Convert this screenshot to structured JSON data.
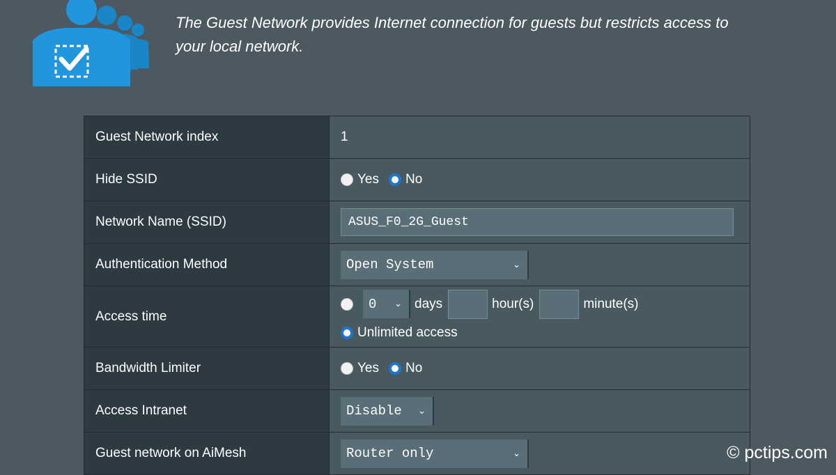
{
  "intro": {
    "text": "The Guest Network provides Internet connection for guests but restricts access to your local network."
  },
  "settings": {
    "index": {
      "label": "Guest Network index",
      "value": "1"
    },
    "hide_ssid": {
      "label": "Hide SSID",
      "options": [
        "Yes",
        "No"
      ],
      "selected": "No"
    },
    "ssid": {
      "label": "Network Name (SSID)",
      "value": "ASUS_F0_2G_Guest"
    },
    "auth": {
      "label": "Authentication Method",
      "selected": "Open System"
    },
    "access_time": {
      "label": "Access time",
      "days_value": "0",
      "days_unit": "days",
      "hours_unit": "hour(s)",
      "minutes_unit": "minute(s)",
      "unlimited_label": "Unlimited access",
      "selected": "Unlimited access"
    },
    "bandwidth": {
      "label": "Bandwidth Limiter",
      "options": [
        "Yes",
        "No"
      ],
      "selected": "No"
    },
    "intranet": {
      "label": "Access Intranet",
      "selected": "Disable"
    },
    "aimesh": {
      "label": "Guest network on AiMesh",
      "selected": "Router only"
    }
  },
  "watermark": "© pctips.com",
  "icons": {
    "header": "guest-network-icon",
    "select": "chevron-down-icon"
  },
  "colors": {
    "background": "#4d5960",
    "label_cell": "#2d3a41",
    "value_cell": "#485960",
    "radio_selected": "#1f76d0",
    "icon_blue": "#1e90d6"
  }
}
